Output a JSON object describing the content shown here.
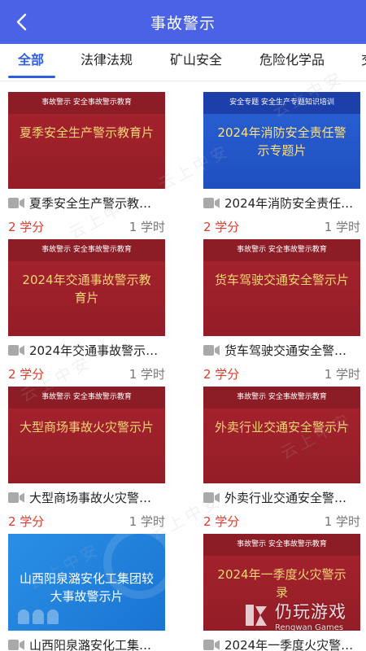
{
  "header": {
    "title": "事故警示"
  },
  "tabs": [
    "全部",
    "法律法规",
    "矿山安全",
    "危险化学品",
    "交"
  ],
  "cards": [
    {
      "band": "事故警示 安全事故警示教育",
      "cover_title": "夏季安全生产警示教育片",
      "title": "夏季安全生产警示教…",
      "credits": "2 学分",
      "hours": "1 学时",
      "theme": "red"
    },
    {
      "band": "安全专题 安全生产专题知识培训",
      "cover_title": "2024年消防安全责任警示专题片",
      "title": "2024年消防安全责任…",
      "credits": "2 学分",
      "hours": "1 学时",
      "theme": "blue"
    },
    {
      "band": "事故警示 安全事故警示教育",
      "cover_title": "2024年交通事故警示教育片",
      "title": "2024年交通事故警示…",
      "credits": "2 学分",
      "hours": "1 学时",
      "theme": "red"
    },
    {
      "band": "事故警示 安全事故警示教育",
      "cover_title": "货车驾驶交通安全警示片",
      "title": "货车驾驶交通安全警…",
      "credits": "2 学分",
      "hours": "1 学时",
      "theme": "red"
    },
    {
      "band": "事故警示 安全事故警示教育",
      "cover_title": "大型商场事故火灾警示片",
      "title": "大型商场事故火灾警…",
      "credits": "2 学分",
      "hours": "1 学时",
      "theme": "red"
    },
    {
      "band": "事故警示 安全事故警示教育",
      "cover_title": "外卖行业交通安全警示片",
      "title": "外卖行业交通安全警…",
      "credits": "2 学分",
      "hours": "1 学时",
      "theme": "red"
    },
    {
      "band": "",
      "cover_title": "山西阳泉潞安化工集团较大事故警示片",
      "title": "山西阳泉潞安化工集…",
      "credits": "",
      "hours": "",
      "theme": "lightblue"
    },
    {
      "band": "事故警示 安全事故警示教育",
      "cover_title": "2024年一季度火灾警示录",
      "title": "2024年一季度火灾警…",
      "credits": "",
      "hours": "",
      "theme": "red"
    }
  ],
  "watermark": "云上中安",
  "brand": {
    "name": "仍玩游戏",
    "sub": "Rengwan Games"
  },
  "colors": {
    "header": "#4a63e6",
    "tab_active": "#2f5ee0",
    "credits": "#e23b2b",
    "cover_red": "#a7232d",
    "cover_blue": "#2a62d6"
  }
}
